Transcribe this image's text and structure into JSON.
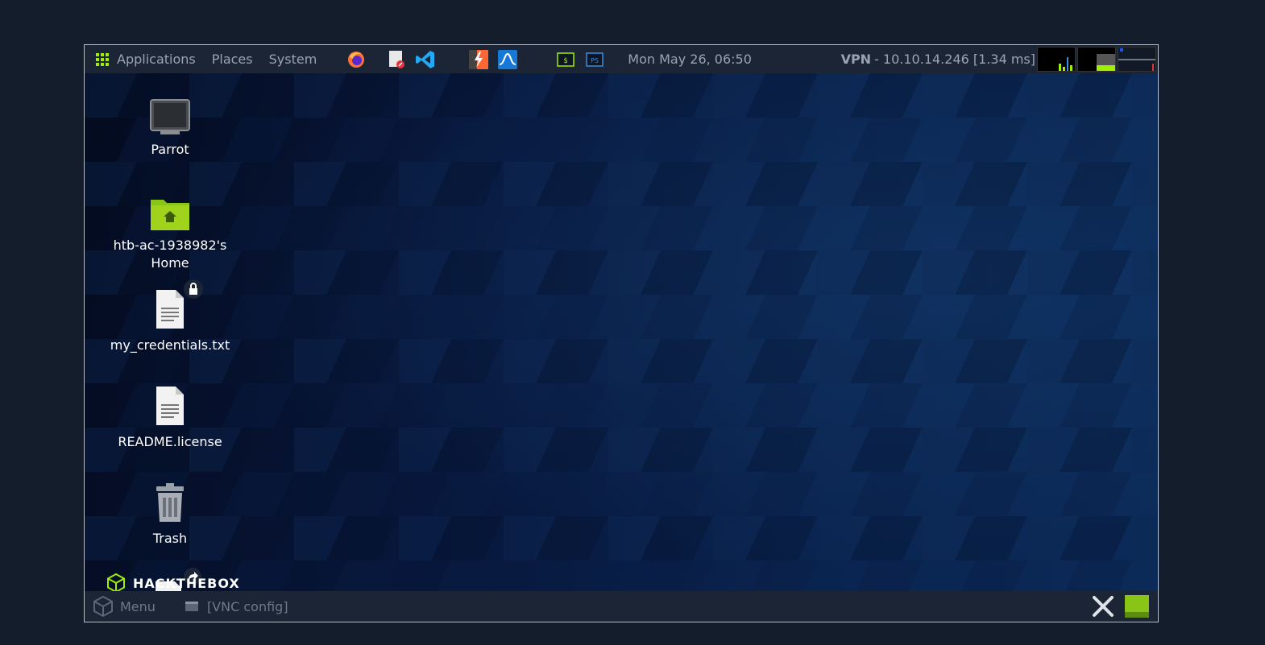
{
  "topbar": {
    "applications": "Applications",
    "places": "Places",
    "system": "System",
    "clock": "Mon May 26, 06:50",
    "vpn_label": "VPN",
    "vpn_info": " - 10.10.14.246 [1.34 ms]"
  },
  "launchers": [
    "firefox-icon",
    "text-editor-icon",
    "vscode-icon",
    "burpsuite-icon",
    "wireshark-icon",
    "terminal-icon",
    "powershell-icon"
  ],
  "desktop": {
    "icons": [
      {
        "label": "Parrot"
      },
      {
        "label": "htb-ac-1938982's Home"
      },
      {
        "label": "my_credentials.txt"
      },
      {
        "label": "README.license"
      },
      {
        "label": "Trash"
      }
    ],
    "logo_text": "HACKTHEBOX"
  },
  "bottombar": {
    "menu": "Menu",
    "window": "[VNC config]"
  },
  "colors": {
    "accent": "#9fef00",
    "panel": "#1b2535",
    "background": "#141d2b"
  }
}
